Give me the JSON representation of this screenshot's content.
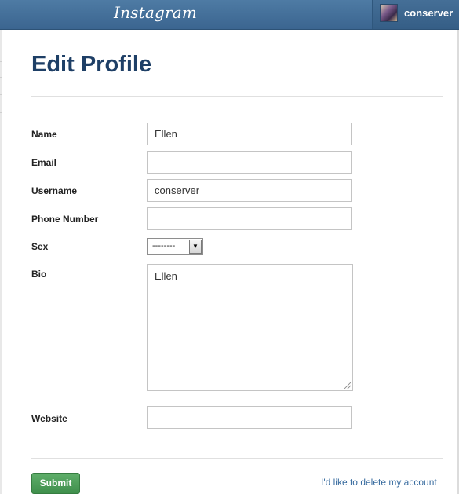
{
  "header": {
    "logo": "Instagram",
    "username": "conserver"
  },
  "page": {
    "title": "Edit Profile"
  },
  "form": {
    "name_label": "Name",
    "name_value": "Ellen",
    "email_label": "Email",
    "email_value": "",
    "username_label": "Username",
    "username_value": "conserver",
    "phone_label": "Phone Number",
    "phone_value": "",
    "sex_label": "Sex",
    "sex_value": "--------",
    "bio_label": "Bio",
    "bio_value": "Ellen",
    "website_label": "Website",
    "website_value": ""
  },
  "actions": {
    "submit_label": "Submit",
    "delete_link": "I'd like to delete my account"
  },
  "colors": {
    "header": "#3f6a94",
    "title": "#1e3f66",
    "submit": "#4a9a56",
    "link": "#3a6da0"
  }
}
